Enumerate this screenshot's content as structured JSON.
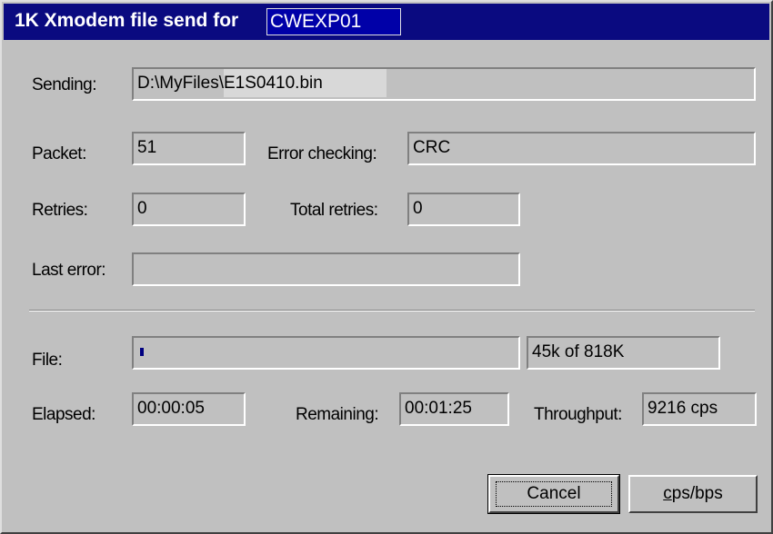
{
  "window": {
    "title": "1K Xmodem file send for",
    "session_name": "CWEXP01"
  },
  "fields": {
    "sending": {
      "label": "Sending:",
      "path": "D:\\MyFiles\\",
      "filename": "E1S0410.bin"
    },
    "packet": {
      "label": "Packet:",
      "value": "51"
    },
    "error_checking": {
      "label": "Error checking:",
      "value": "CRC"
    },
    "retries": {
      "label": "Retries:",
      "value": "0"
    },
    "total_retries": {
      "label": "Total retries:",
      "value": "0"
    },
    "last_error": {
      "label": "Last error:",
      "value": ""
    },
    "file": {
      "label": "File:",
      "progress_fraction": 0.055,
      "progress_text": "45k of 818K"
    },
    "elapsed": {
      "label": "Elapsed:",
      "value": "00:00:05"
    },
    "remaining": {
      "label": "Remaining:",
      "value": "00:01:25"
    },
    "throughput": {
      "label": "Throughput:",
      "value": "9216 cps"
    }
  },
  "buttons": {
    "cancel": "Cancel",
    "cps_bps_hotkey": "c",
    "cps_bps_rest": "ps/bps"
  },
  "colors": {
    "titlebar": "#0a0a80",
    "dialog_face": "#c0c0c0",
    "progress": "#000080"
  }
}
